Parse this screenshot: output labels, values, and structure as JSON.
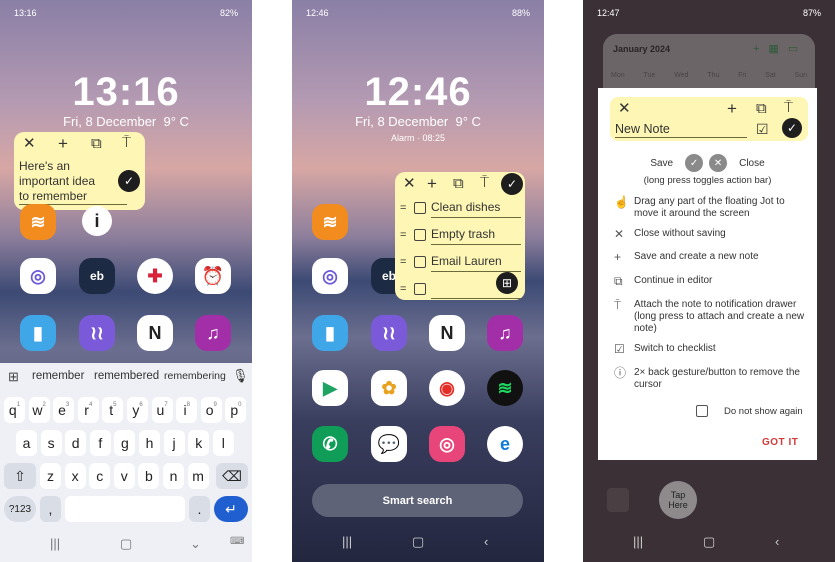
{
  "panel1": {
    "status": {
      "time": "13:16",
      "battery": "82%"
    },
    "clock": "13:16",
    "date": "Fri, 8 December",
    "weather": "9° C",
    "note": {
      "text": [
        "Here's an",
        "important idea",
        "to remember"
      ]
    },
    "keyboard": {
      "suggestions": [
        "remember",
        "remembered",
        "remembering"
      ],
      "row1": [
        "q",
        "w",
        "e",
        "r",
        "t",
        "y",
        "u",
        "i",
        "o",
        "p"
      ],
      "row1_hints": [
        "1",
        "2",
        "3",
        "4",
        "5",
        "6",
        "7",
        "8",
        "9",
        "0"
      ],
      "row2": [
        "a",
        "s",
        "d",
        "f",
        "g",
        "h",
        "j",
        "k",
        "l"
      ],
      "row3": [
        "z",
        "x",
        "c",
        "v",
        "b",
        "n",
        "m"
      ],
      "symbols_key": "?123",
      "comma_key": ",",
      "period_key": "."
    }
  },
  "panel2": {
    "status": {
      "time": "12:46",
      "battery": "88%"
    },
    "clock": "12:46",
    "date": "Fri, 8 December",
    "weather": "9° C",
    "alarm": "Alarm · 08:25",
    "checklist": [
      {
        "text": "Clean dishes",
        "checked": false
      },
      {
        "text": "Empty trash",
        "checked": false
      },
      {
        "text": "Email Lauren",
        "checked": false
      },
      {
        "text": "",
        "checked": false
      }
    ],
    "smart_search": "Smart search"
  },
  "panel3": {
    "status": {
      "time": "12:47",
      "battery": "87%"
    },
    "calendar": {
      "month": "January 2024",
      "days": [
        "Mon",
        "Tue",
        "Wed",
        "Thu",
        "Fri",
        "Sat",
        "Sun"
      ]
    },
    "note": {
      "placeholder": "New Note"
    },
    "save_label": "Save",
    "close_label": "Close",
    "hint": "(long press toggles action bar)",
    "items": [
      {
        "icon": "drag-hand-icon",
        "text": "Drag any part of the floating Jot to move it around the screen"
      },
      {
        "icon": "close-icon",
        "text": "Close without saving"
      },
      {
        "icon": "plus-icon",
        "text": "Save and create a new note"
      },
      {
        "icon": "open-editor-icon",
        "text": "Continue in editor"
      },
      {
        "icon": "pin-icon",
        "text": "Attach the note to notification drawer (long press to attach and create a new note)"
      },
      {
        "icon": "checklist-icon",
        "text": "Switch to checklist"
      },
      {
        "icon": "info-icon",
        "text": "2× back gesture/button to remove the cursor"
      }
    ],
    "do_not_show": "Do not show again",
    "got_it": "GOT IT",
    "tap_here": "Tap Here"
  },
  "colors": {
    "note": "#fdf6b4",
    "accent_red": "#d33b3b",
    "enter_blue": "#1f5fd0"
  }
}
